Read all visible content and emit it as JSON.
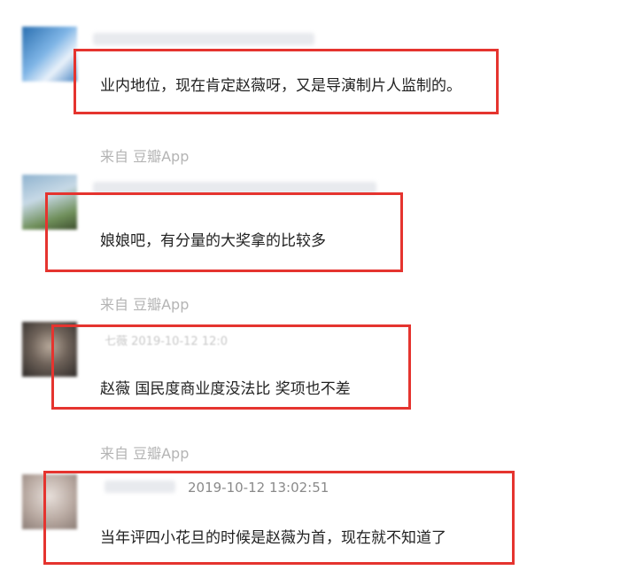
{
  "colors": {
    "highlight_box": "#e5342f",
    "comment_text": "#222222",
    "source_text": "#b4b4b4"
  },
  "comments": [
    {
      "text": "业内地位，现在肯定赵薇呀，又是导演制片人监制的。",
      "source": "来自 豆瓣App"
    },
    {
      "text": "娘娘吧，有分量的大奖拿的比较多",
      "source": "来自 豆瓣App"
    },
    {
      "text": "赵薇 国民度商业度没法比 奖项也不差",
      "source": "来自 豆瓣App"
    },
    {
      "text": "当年评四小花旦的时候是赵薇为首，现在就不知道了",
      "timestamp": "2019-10-12 13:02:51"
    }
  ]
}
